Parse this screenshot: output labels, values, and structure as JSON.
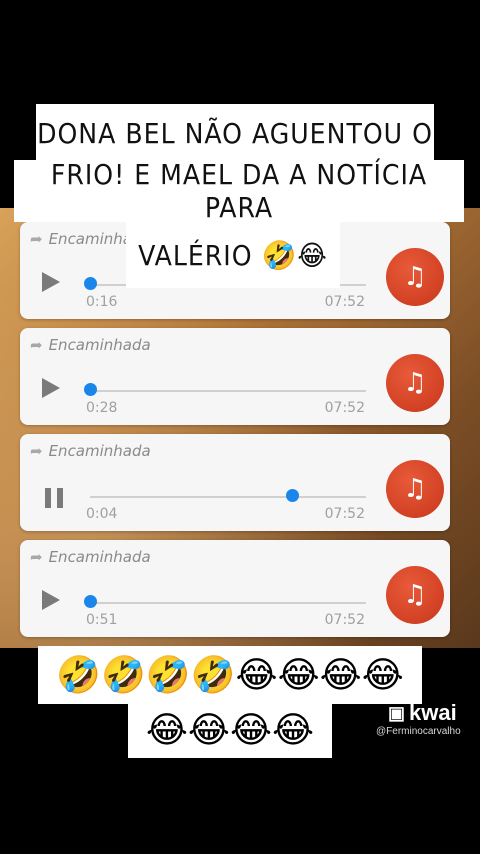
{
  "caption": {
    "line1": "DONA BEL NÃO AGUENTOU O",
    "line2": "FRIO! E MAEL DA A NOTÍCIA PARA",
    "line3": "VALÉRIO 🤣😂"
  },
  "messages": [
    {
      "forwarded": "Encaminhada",
      "elapsed": "0:16",
      "duration": "07:52",
      "state": "play",
      "progress": 0.0
    },
    {
      "forwarded": "Encaminhada",
      "elapsed": "0:28",
      "duration": "07:52",
      "state": "play",
      "progress": 0.0
    },
    {
      "forwarded": "Encaminhada",
      "elapsed": "0:04",
      "duration": "07:52",
      "state": "pause",
      "progress": 0.74
    },
    {
      "forwarded": "Encaminhada",
      "elapsed": "0:51",
      "duration": "07:52",
      "state": "play",
      "progress": 0.0
    }
  ],
  "emoji_row1": "🤣🤣🤣🤣😂😂😂😂",
  "emoji_row2": "😂😂😂😂",
  "watermark": {
    "brand": "kwai",
    "handle": "@Ferminocarvalho"
  },
  "colors": {
    "progress_dot": "#1a86ea",
    "music_button": "#d7411f"
  },
  "icons": {
    "forward": "forward-arrow-icon",
    "play": "play-icon",
    "pause": "pause-icon",
    "music": "music-note-icon"
  }
}
